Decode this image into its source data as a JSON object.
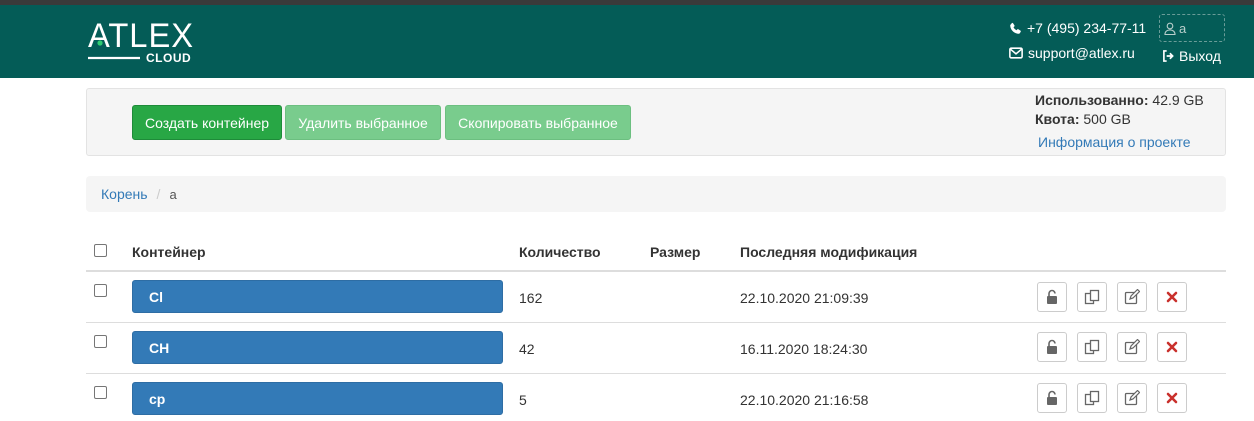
{
  "header": {
    "logo_text": "ATLEX",
    "logo_sub": "CLOUD",
    "phone": "+7 (495) 234-77-11",
    "email": "support@atlex.ru",
    "username": "a",
    "logout_label": "Выход",
    "bg_color": "#045c57"
  },
  "toolbar": {
    "create_label": "Создать контейнер",
    "delete_label": "Удалить выбранное",
    "copy_label": "Скопировать выбранное"
  },
  "usage": {
    "used_label": "Использованно:",
    "used_value": "42.9 GB",
    "quota_label": "Квота:",
    "quota_value": "500 GB",
    "project_link": "Информация о проекте"
  },
  "breadcrumb": {
    "root": "Корень",
    "separator": "/",
    "current": "a"
  },
  "table": {
    "columns": [
      "Контейнер",
      "Количество",
      "Размер",
      "Последняя модификация"
    ],
    "rows": [
      {
        "name": "Cl",
        "count": "162",
        "size": "",
        "modified": "22.10.2020 21:09:39"
      },
      {
        "name": "CH",
        "count": "42",
        "size": "",
        "modified": "16.11.2020 18:24:30"
      },
      {
        "name": "cp",
        "count": "5",
        "size": "",
        "modified": "22.10.2020 21:16:58"
      }
    ],
    "row_actions": [
      "unlock-icon",
      "copy-icon",
      "edit-icon",
      "delete-icon"
    ]
  },
  "colors": {
    "primary_green": "#28a745",
    "disabled_green": "#79cc8d",
    "container_blue": "#337ab7",
    "delete_red": "#c9302c"
  }
}
